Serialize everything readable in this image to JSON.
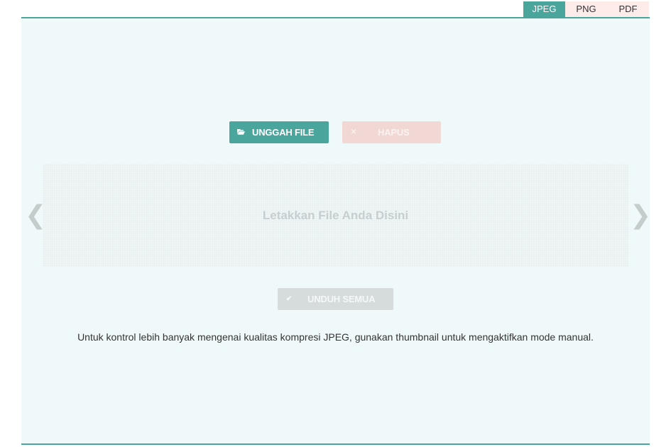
{
  "format_tabs": [
    {
      "label": "JPEG",
      "active": true
    },
    {
      "label": "PNG",
      "active": false
    },
    {
      "label": "PDF",
      "active": false
    }
  ],
  "toolbar": {
    "upload_label": "UNGGAH FILE",
    "upload_icon": "folder-open-icon",
    "clear_label": "HAPUS",
    "clear_icon": "close-icon"
  },
  "dropzone": {
    "text": "Letakkan File Anda Disini"
  },
  "carousel": {
    "prev_glyph": "❮",
    "next_glyph": "❯"
  },
  "download": {
    "label": "UNDUH SEMUA",
    "icon": "check-icon"
  },
  "info_text": "Untuk kontrol lebih banyak mengenai kualitas kompresi JPEG, gunakan thumbnail untuk mengaktifkan mode manual.",
  "colors": {
    "accent": "#4aa59d",
    "panel_bg": "#f0f9f9",
    "tab_inactive_bg": "#fdecea",
    "clear_button_bg": "#f1d8d4",
    "download_button_bg": "#d5dcdb"
  }
}
